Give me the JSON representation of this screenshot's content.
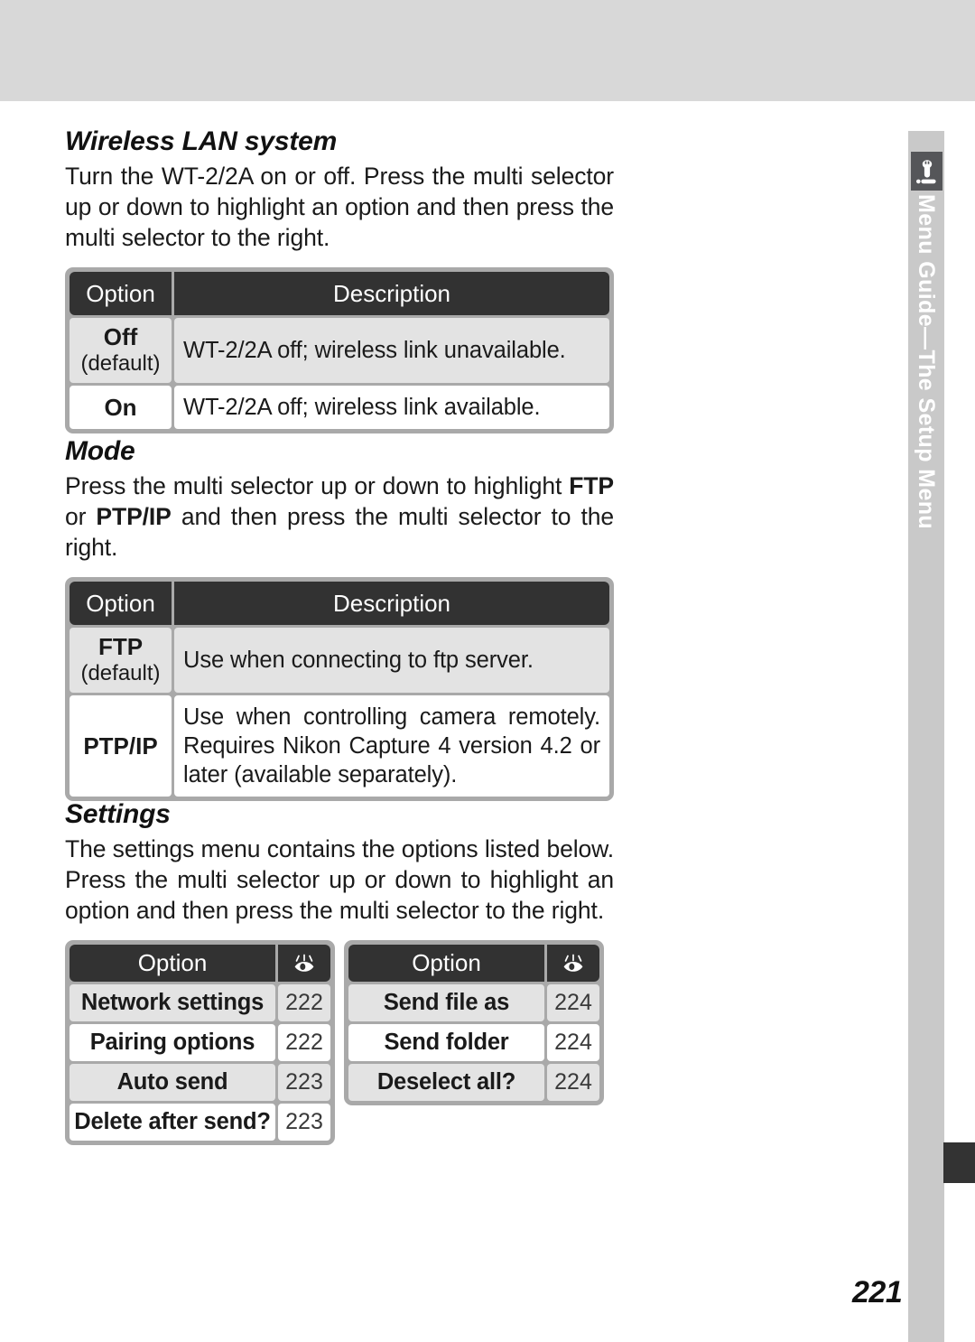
{
  "page": {
    "number": "221",
    "side_tab_label": "Menu Guide—The Setup Menu",
    "side_tab_icon": "wrench-setup-icon",
    "header_band_color": "#d8d8d8",
    "rail_color": "#c9c9c9",
    "dark_color": "#323232"
  },
  "sections": {
    "wireless": {
      "heading": "Wireless LAN system",
      "paragraph_parts": {
        "p1": "Turn the WT-2/2A on or off.  Press the multi selector up or down to highlight an option and then press the multi selector to the right."
      },
      "table": {
        "header": {
          "option": "Option",
          "description": "Description"
        },
        "rows": [
          {
            "option": "Off",
            "option_sub": "(default)",
            "description": "WT-2/2A off; wireless link unavailable."
          },
          {
            "option": "On",
            "option_sub": "",
            "description": "WT-2/2A off; wireless link available."
          }
        ]
      }
    },
    "mode": {
      "heading": "Mode",
      "paragraph_parts": {
        "pre": "Press the multi selector up or down to highlight ",
        "b1": "FTP",
        "mid": " or ",
        "b2": "PTP/IP",
        "post": " and then press the multi selector to the right."
      },
      "table": {
        "header": {
          "option": "Option",
          "description": "Description"
        },
        "rows": [
          {
            "option": "FTP",
            "option_sub": "(default)",
            "description": "Use when connecting to ftp server."
          },
          {
            "option": "PTP/IP",
            "option_sub": "",
            "description": "Use when controlling camera remotely.  Requires Nikon Capture 4 version 4.2 or later (available separately)."
          }
        ]
      }
    },
    "settings": {
      "heading": "Settings",
      "paragraph_parts": {
        "p1": "The settings menu contains the options listed below.  Press the multi selector up or down to highlight an option and then press the multi selector to the right."
      },
      "left_table": {
        "header_label": "Option",
        "header_icon": "eye-page-reference-icon",
        "rows": [
          {
            "label": "Network settings",
            "page": "222"
          },
          {
            "label": "Pairing options",
            "page": "222"
          },
          {
            "label": "Auto send",
            "page": "223"
          },
          {
            "label": "Delete after send?",
            "page": "223"
          }
        ]
      },
      "right_table": {
        "header_label": "Option",
        "header_icon": "eye-page-reference-icon",
        "rows": [
          {
            "label": "Send file as",
            "page": "224"
          },
          {
            "label": "Send folder",
            "page": "224"
          },
          {
            "label": "Deselect all?",
            "page": "224"
          }
        ]
      }
    }
  }
}
